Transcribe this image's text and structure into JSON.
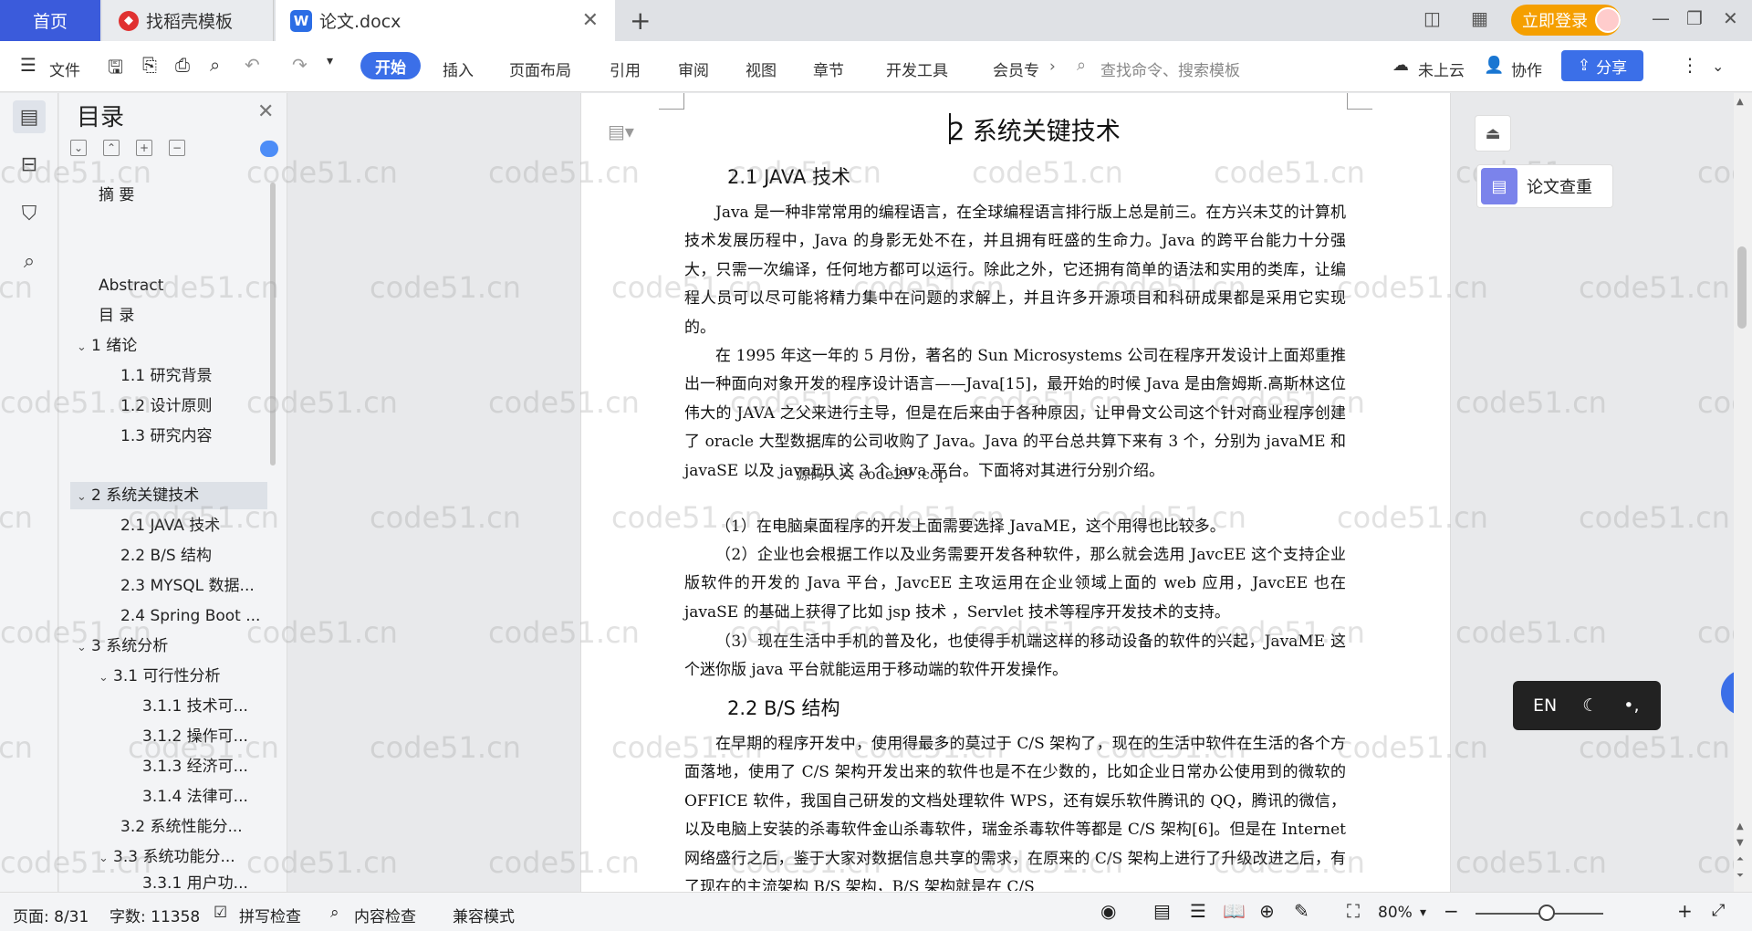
{
  "tabs": {
    "home": "首页",
    "templates": "找稻壳模板",
    "doc": "论文.docx"
  },
  "login_label": "立即登录",
  "ribbon": {
    "file": "文件",
    "start": "开始",
    "insert": "插入",
    "layout": "页面布局",
    "reference": "引用",
    "review": "审阅",
    "view": "视图",
    "chapter": "章节",
    "devtools": "开发工具",
    "member": "会员专",
    "search_placeholder": "查找命令、搜索模板",
    "cloud": "未上云",
    "collab": "协作",
    "share": "分享"
  },
  "toc": {
    "title": "目录",
    "items": [
      {
        "label": "摘  要"
      },
      {
        "label": "Abstract"
      },
      {
        "label": "目  录"
      },
      {
        "label": "1  绪论"
      },
      {
        "label": "1.1  研究背景"
      },
      {
        "label": "1.2  设计原则"
      },
      {
        "label": "1.3  研究内容"
      },
      {
        "label": "2  系统关键技术"
      },
      {
        "label": "2.1 JAVA 技术"
      },
      {
        "label": "2.2 B/S 结构"
      },
      {
        "label": "2.3 MYSQL 数据..."
      },
      {
        "label": "2.4 Spring Boot ..."
      },
      {
        "label": "3  系统分析"
      },
      {
        "label": "3.1  可行性分析"
      },
      {
        "label": "3.1.1  技术可..."
      },
      {
        "label": "3.1.2  操作可..."
      },
      {
        "label": "3.1.3  经济可..."
      },
      {
        "label": "3.1.4  法律可..."
      },
      {
        "label": "3.2 系统性能分..."
      },
      {
        "label": "3.3 系统功能分..."
      },
      {
        "label": "3.3.1 用户功..."
      }
    ]
  },
  "doc": {
    "h1": "2  系统关键技术",
    "h2_1": "2.1  JAVA 技术",
    "p1": "Java 是一种非常常用的编程语言，在全球编程语言排行版上总是前三。在方兴未艾的计算机技术发展历程中，Java 的身影无处不在，并且拥有旺盛的生命力。Java 的跨平台能力十分强大，只需一次编译，任何地方都可以运行。除此之外，它还拥有简单的语法和实用的类库，让编程人员可以尽可能将精力集中在问题的求解上，并且许多开源项目和科研成果都是采用它实现的。",
    "p2": "在 1995 年这一年的 5 月份，著名的 Sun Microsystems 公司在程序开发设计上面郑重推出一种面向对象开发的程序设计语言——Java[15]，最开始的时候 Java 是由詹姆斯.高斯林这位伟大的 JAVA 之父来进行主导，但是在后来由于各种原因，让甲骨文公司这个针对商业程序创建了 oracle 大型数据库的公司收购了 Java。Java 的平台总共算下来有 3 个，分别为 javaME 和 javaSE 以及 javaEE 这 3 个 java 平台。下面将对其进行分别介绍。",
    "p3": "（1）在电脑桌面程序的开发上面需要选择 JavaME，这个用得也比较多。",
    "p4": "（2）企业也会根据工作以及业务需要开发各种软件，那么就会选用 JavcEE 这个支持企业版软件的开发的 Java 平台，JavcEE 主攻运用在企业领域上面的 web 应用，JavcEE 也在 javaSE 的基础上获得了比如 jsp 技术 ，Servlet 技术等程序开发技术的支持。",
    "p5": "（3）现在生活中手机的普及化，也使得手机端这样的移动设备的软件的兴起，JavaME 这个迷你版 java 平台就能运用于移动端的软件开发操作。",
    "h2_2": "2.2  B/S 结构",
    "p6": "在早期的程序开发中，使用得最多的莫过于 C/S 架构了，现在的生活中软件在生活的各个方面落地，使用了 C/S 架构开发出来的软件也是不在少数的，比如企业日常办公使用到的微软的 OFFICE 软件，我国自己研发的文档处理软件 WPS，还有娱乐软件腾讯的 QQ，腾讯的微信，以及电脑上安装的杀毒软件金山杀毒软件，瑞金杀毒软件等都是 C/S 架构[6]。但是在 Internet 网络盛行之后，鉴于大家对数据信息共享的需求，在原来的 C/S 架构上进行了升级改进之后，有了现在的主流架构 B/S 架构，B/S 架构就是在 C/S",
    "overlay_text": "源码人人 code29 .cop"
  },
  "watermark": "code51.cn",
  "right_panel": {
    "check": "论文查重"
  },
  "input_method": "EN",
  "status": {
    "page": "页面: 8/31",
    "words": "字数: 11358",
    "spell": "拼写检查",
    "content": "内容检查",
    "compat": "兼容模式",
    "zoom": "80%"
  }
}
